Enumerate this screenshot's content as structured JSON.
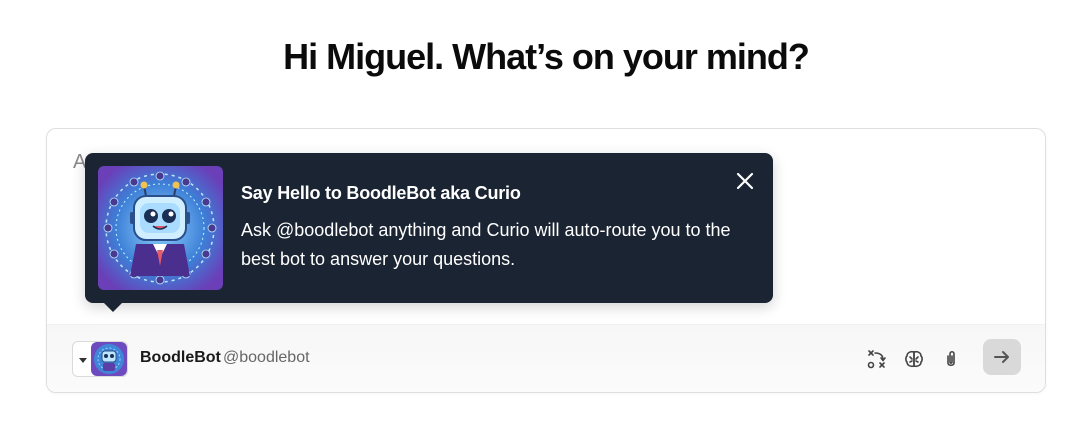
{
  "greeting": "Hi Miguel. What’s on your mind?",
  "composer": {
    "placeholder": "Ask anything"
  },
  "popover": {
    "title": "Say Hello to BoodleBot aka Curio",
    "body": "Ask @boodlebot anything and Curio will auto-route you to the best bot to answer your questions.",
    "image_icon": "robot-avatar-icon",
    "close_icon": "close-icon"
  },
  "footer": {
    "bot_name": "BoodleBot",
    "bot_handle": "@boodlebot",
    "tools": [
      {
        "icon": "workflow-icon"
      },
      {
        "icon": "brain-icon"
      },
      {
        "icon": "paperclip-icon"
      }
    ],
    "send_icon": "arrow-right-icon"
  },
  "colors": {
    "popover_bg": "#1b2432",
    "avatar_bg": "#3d7fd6",
    "avatar_border": "#7a4cc2",
    "send_bg": "#d9d9d9"
  }
}
